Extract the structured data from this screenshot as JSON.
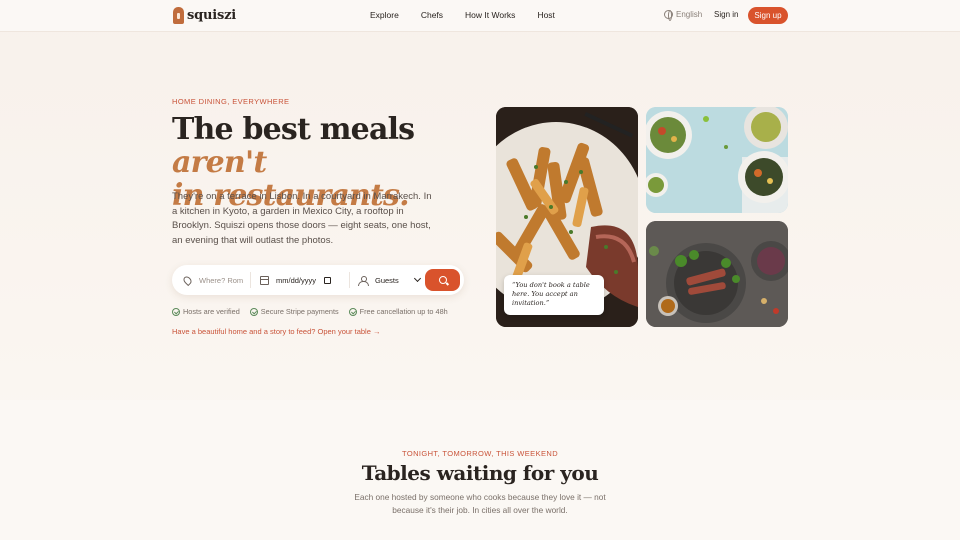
{
  "nav": {
    "brand": "squiszi",
    "links": [
      "Explore",
      "Chefs",
      "How It Works",
      "Host"
    ],
    "language": "English",
    "signin": "Sign in",
    "signup": "Sign up"
  },
  "hero": {
    "eyebrow": "HOME DINING, EVERYWHERE",
    "headline_plain": "The best meals ",
    "headline_accent_1": "aren't",
    "headline_accent_2": "in restaurants.",
    "lede": "They're on a terrace in Lisbon. In a courtyard in Marrakech. In a kitchen in Kyoto, a garden in Mexico City, a rooftop in Brooklyn. Squiszi opens those doors — eight seats, one host, an evening that will outlast the photos."
  },
  "search": {
    "where_placeholder": "Where? Rom",
    "date_placeholder": "mm/dd/yyyy",
    "guests_value": "Guests"
  },
  "trust": [
    "Hosts are verified",
    "Secure Stripe payments",
    "Free cancellation up to 48h"
  ],
  "host_link": "Have a beautiful home and a story to feed? Open your table →",
  "quote": "“You don't book a table here. You accept an invitation.”",
  "section2": {
    "eyebrow": "TONIGHT, TOMORROW, THIS WEEKEND",
    "title": "Tables waiting for you",
    "subtitle": "Each one hosted by someone who cooks because they love it — not because it's their job. In cities all over the world."
  },
  "colors": {
    "accent": "#d9532c",
    "eyebrow": "#c9543a",
    "headline_accent": "#c47b45"
  }
}
